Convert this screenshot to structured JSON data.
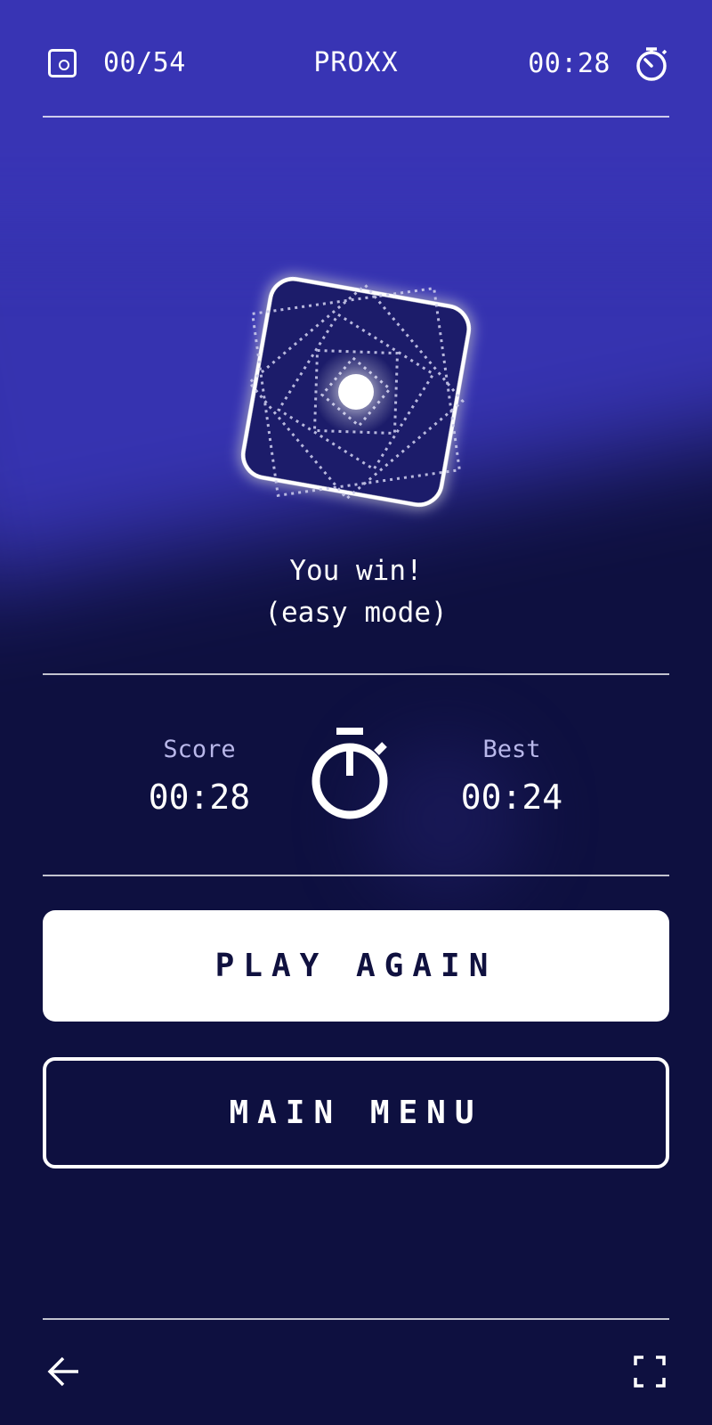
{
  "header": {
    "progress": "00/54",
    "title": "PROXX",
    "timer": "00:28"
  },
  "result": {
    "line1": "You win!",
    "line2": "(easy mode)"
  },
  "stats": {
    "score_label": "Score",
    "score_value": "00:28",
    "best_label": "Best",
    "best_value": "00:24"
  },
  "buttons": {
    "play_again": "PLAY AGAIN",
    "main_menu": "MAIN MENU"
  },
  "icons": {
    "cells": "cell-icon",
    "timer": "stopwatch-icon",
    "back": "arrow-left-icon",
    "fullscreen": "fullscreen-icon"
  },
  "colors": {
    "background_top": "#3633b0",
    "background_bottom": "#0e1040",
    "button_primary": "#ffffff",
    "button_text_dark": "#10113f",
    "label_muted": "#b9b8ea"
  }
}
